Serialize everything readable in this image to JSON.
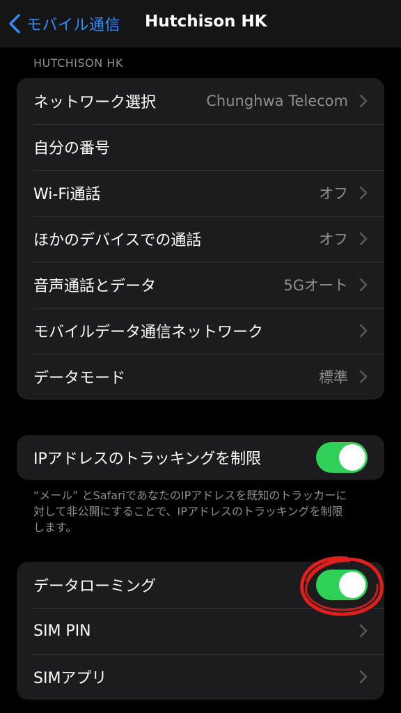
{
  "nav": {
    "back_label": "モバイル通信",
    "title": "Hutchison HK"
  },
  "section_header": "HUTCHISON HK",
  "group1": [
    {
      "label": "ネットワーク選択",
      "value": "Chunghwa Telecom",
      "chevron": true
    },
    {
      "label": "自分の番号",
      "value": "",
      "chevron": false
    },
    {
      "label": "Wi-Fi通話",
      "value": "オフ",
      "chevron": true
    },
    {
      "label": "ほかのデバイスでの通話",
      "value": "オフ",
      "chevron": true
    },
    {
      "label": "音声通話とデータ",
      "value": "5Gオート",
      "chevron": true
    },
    {
      "label": "モバイルデータ通信ネットワーク",
      "value": "",
      "chevron": true
    },
    {
      "label": "データモード",
      "value": "標準",
      "chevron": true
    }
  ],
  "group2": {
    "label": "IPアドレスのトラッキングを制限",
    "toggle_on": true,
    "footnote": "“メール” とSafariであなたのIPアドレスを既知のトラッカーに対して非公開にすることで、IPアドレスのトラッキングを制限します。"
  },
  "group3": [
    {
      "label": "データローミング",
      "toggle_on": true
    },
    {
      "label": "SIM PIN",
      "chevron": true
    },
    {
      "label": "SIMアプリ",
      "chevron": true
    }
  ],
  "colors": {
    "accent": "#2f8cff",
    "toggle_on": "#30d158",
    "annotation": "#e0201c"
  }
}
